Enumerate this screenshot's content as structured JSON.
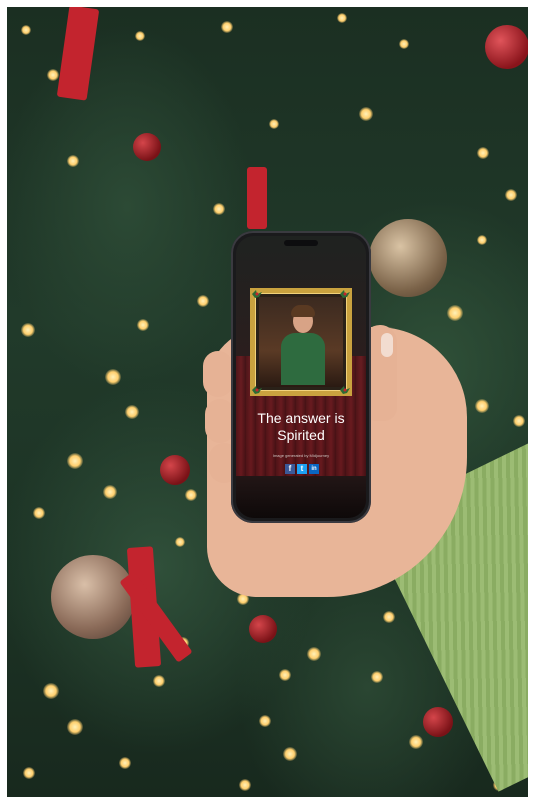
{
  "scene": {
    "description_colors": {
      "background_tree": "#1c3224",
      "bokeh_light": "#ffcf6e",
      "ornament_red": "#b3202a",
      "ornament_gold": "#a88a62",
      "sweater": "#9cbc74",
      "skin": "#e8b598"
    }
  },
  "phone_screen": {
    "answer_line1": "The answer is",
    "answer_line2": "Spirited",
    "credit": "Image generated by Midjourney",
    "share": {
      "facebook_label": "f",
      "twitter_label": "t",
      "linkedin_label": "in",
      "facebook_color": "#3b5998",
      "twitter_color": "#1da1f2",
      "linkedin_color": "#0a66c2"
    },
    "frame_color": "#c9a23f"
  },
  "icons": [
    "facebook-icon",
    "twitter-icon",
    "linkedin-icon",
    "holly-icon"
  ]
}
